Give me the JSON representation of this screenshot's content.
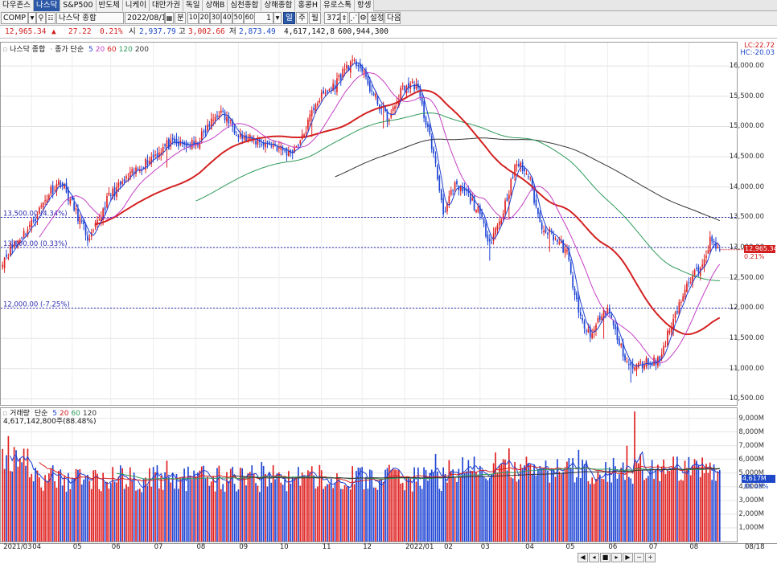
{
  "tabs": [
    {
      "label": "다우존스",
      "active": false
    },
    {
      "label": "나스닥",
      "active": true
    },
    {
      "label": "S&P500",
      "active": false
    },
    {
      "label": "반도체",
      "active": false
    },
    {
      "label": "니케이",
      "active": false
    },
    {
      "label": "대만가권",
      "active": false
    },
    {
      "label": "독일",
      "active": false
    },
    {
      "label": "상해B",
      "active": false
    },
    {
      "label": "심천종합",
      "active": false
    },
    {
      "label": "상해종합",
      "active": false
    },
    {
      "label": "홍콩H",
      "active": false
    },
    {
      "label": "유로스톡",
      "active": false
    },
    {
      "label": "항셍",
      "active": false
    }
  ],
  "toolbar": {
    "code": "COMP",
    "name": "나스닥 종합",
    "date": "2022/08/1",
    "unit_label": "분",
    "periods": [
      "10",
      "20",
      "30",
      "40",
      "50",
      "60"
    ],
    "interval_value": "1",
    "view_options": [
      {
        "label": "일",
        "active": true
      },
      {
        "label": "주",
        "active": false
      },
      {
        "label": "월",
        "active": false
      }
    ],
    "count": "372",
    "settings_label": "설정",
    "next_label": "다음"
  },
  "quote": {
    "price": "12,965.34",
    "change": "27.22",
    "change_pct": "0.21%",
    "open_label": "시",
    "open": "2,937.79",
    "high_label": "고",
    "high": "3,002.66",
    "low_label": "저",
    "low": "2,873.49",
    "volume": "4,617,142,8",
    "amount": "600,944,300"
  },
  "price_pane": {
    "legend_title": "나스닥 종합",
    "legend_ma_label": "종가 단순",
    "ma_periods": [
      "5",
      "20",
      "60",
      "120",
      "200"
    ],
    "ma_colors": [
      "#1e3fd0",
      "#c53fc5",
      "#d42020",
      "#2e9a5a",
      "#333333"
    ],
    "ref_lines": [
      {
        "value": 13500,
        "label": "13,500.00 (4.34%)"
      },
      {
        "value": 13000,
        "label": "13,000.00 (0.33%)"
      },
      {
        "value": 12000,
        "label": "12,000.00 (-7.25%)"
      }
    ],
    "y_ticks": [
      "16,000.00",
      "15,500.00",
      "15,000.00",
      "14,500.00",
      "14,000.00",
      "13,500.00",
      "13,000.00",
      "12,500.00",
      "12,000.00",
      "11,500.00",
      "11,000.00",
      "10,500.00"
    ],
    "hi_label": "LC:22.72",
    "lo_label": "HC:-20.03",
    "current_tag": "12,965.34",
    "current_pct": "0.21%"
  },
  "volume_pane": {
    "legend_title": "거래량",
    "legend_ma_label": "단순",
    "ma_periods": [
      "5",
      "20",
      "60",
      "120"
    ],
    "ma_colors": [
      "#1e3fd0",
      "#d42020",
      "#2e9a5a",
      "#333333"
    ],
    "sub_label": "4,617,142,800주(88.48%)",
    "y_ticks": [
      "9,000M",
      "8,000M",
      "7,000M",
      "6,000M",
      "5,000M",
      "4,000M",
      "3,000M",
      "2,000M",
      "1,000M"
    ],
    "current_tag": "4,617M",
    "current_pct": "88.48%"
  },
  "x_axis": [
    "2021/03",
    "04",
    "05",
    "06",
    "07",
    "08",
    "09",
    "10",
    "11",
    "12",
    "2022/01",
    "02",
    "03",
    "04",
    "05",
    "06",
    "07",
    "08",
    "08/18"
  ],
  "nav_icons": [
    "scroll-left-icon",
    "scroll-back-icon",
    "pause-icon",
    "scroll-forward-icon",
    "scroll-right-icon",
    "zoom-out-icon",
    "zoom-in-icon"
  ],
  "chart_data": {
    "type": "candlestick",
    "title": "나스닥 종합",
    "x_range": [
      "2021/03",
      "2022/08/18"
    ],
    "ylim": [
      10400,
      16400
    ],
    "volume_ylim_millions": [
      0,
      9800
    ],
    "anchors": [
      {
        "i": 0,
        "c": 12800
      },
      {
        "i": 15,
        "c": 13400
      },
      {
        "i": 25,
        "c": 13950
      },
      {
        "i": 30,
        "c": 14100
      },
      {
        "i": 40,
        "c": 13450
      },
      {
        "i": 45,
        "c": 13100
      },
      {
        "i": 55,
        "c": 13850
      },
      {
        "i": 70,
        "c": 14300
      },
      {
        "i": 85,
        "c": 14700
      },
      {
        "i": 100,
        "c": 14700
      },
      {
        "i": 112,
        "c": 15250
      },
      {
        "i": 125,
        "c": 14800
      },
      {
        "i": 140,
        "c": 14700
      },
      {
        "i": 148,
        "c": 14550
      },
      {
        "i": 155,
        "c": 14800
      },
      {
        "i": 162,
        "c": 15400
      },
      {
        "i": 172,
        "c": 15700
      },
      {
        "i": 178,
        "c": 16000
      },
      {
        "i": 184,
        "c": 16050
      },
      {
        "i": 192,
        "c": 15500
      },
      {
        "i": 200,
        "c": 15100
      },
      {
        "i": 207,
        "c": 15650
      },
      {
        "i": 214,
        "c": 15700
      },
      {
        "i": 222,
        "c": 14700
      },
      {
        "i": 228,
        "c": 13600
      },
      {
        "i": 234,
        "c": 14000
      },
      {
        "i": 240,
        "c": 13900
      },
      {
        "i": 246,
        "c": 13600
      },
      {
        "i": 252,
        "c": 13100
      },
      {
        "i": 258,
        "c": 13500
      },
      {
        "i": 266,
        "c": 14400
      },
      {
        "i": 272,
        "c": 14200
      },
      {
        "i": 278,
        "c": 13400
      },
      {
        "i": 285,
        "c": 13200
      },
      {
        "i": 292,
        "c": 12900
      },
      {
        "i": 298,
        "c": 11900
      },
      {
        "i": 304,
        "c": 11500
      },
      {
        "i": 308,
        "c": 11800
      },
      {
        "i": 313,
        "c": 12000
      },
      {
        "i": 319,
        "c": 11400
      },
      {
        "i": 325,
        "c": 11000
      },
      {
        "i": 333,
        "c": 11100
      },
      {
        "i": 340,
        "c": 11150
      },
      {
        "i": 347,
        "c": 11850
      },
      {
        "i": 354,
        "c": 12350
      },
      {
        "i": 360,
        "c": 12650
      },
      {
        "i": 366,
        "c": 13100
      },
      {
        "i": 371,
        "c": 12965
      }
    ],
    "moving_averages": [
      "5",
      "20",
      "60",
      "120",
      "200"
    ],
    "last_close": 12965.34
  }
}
